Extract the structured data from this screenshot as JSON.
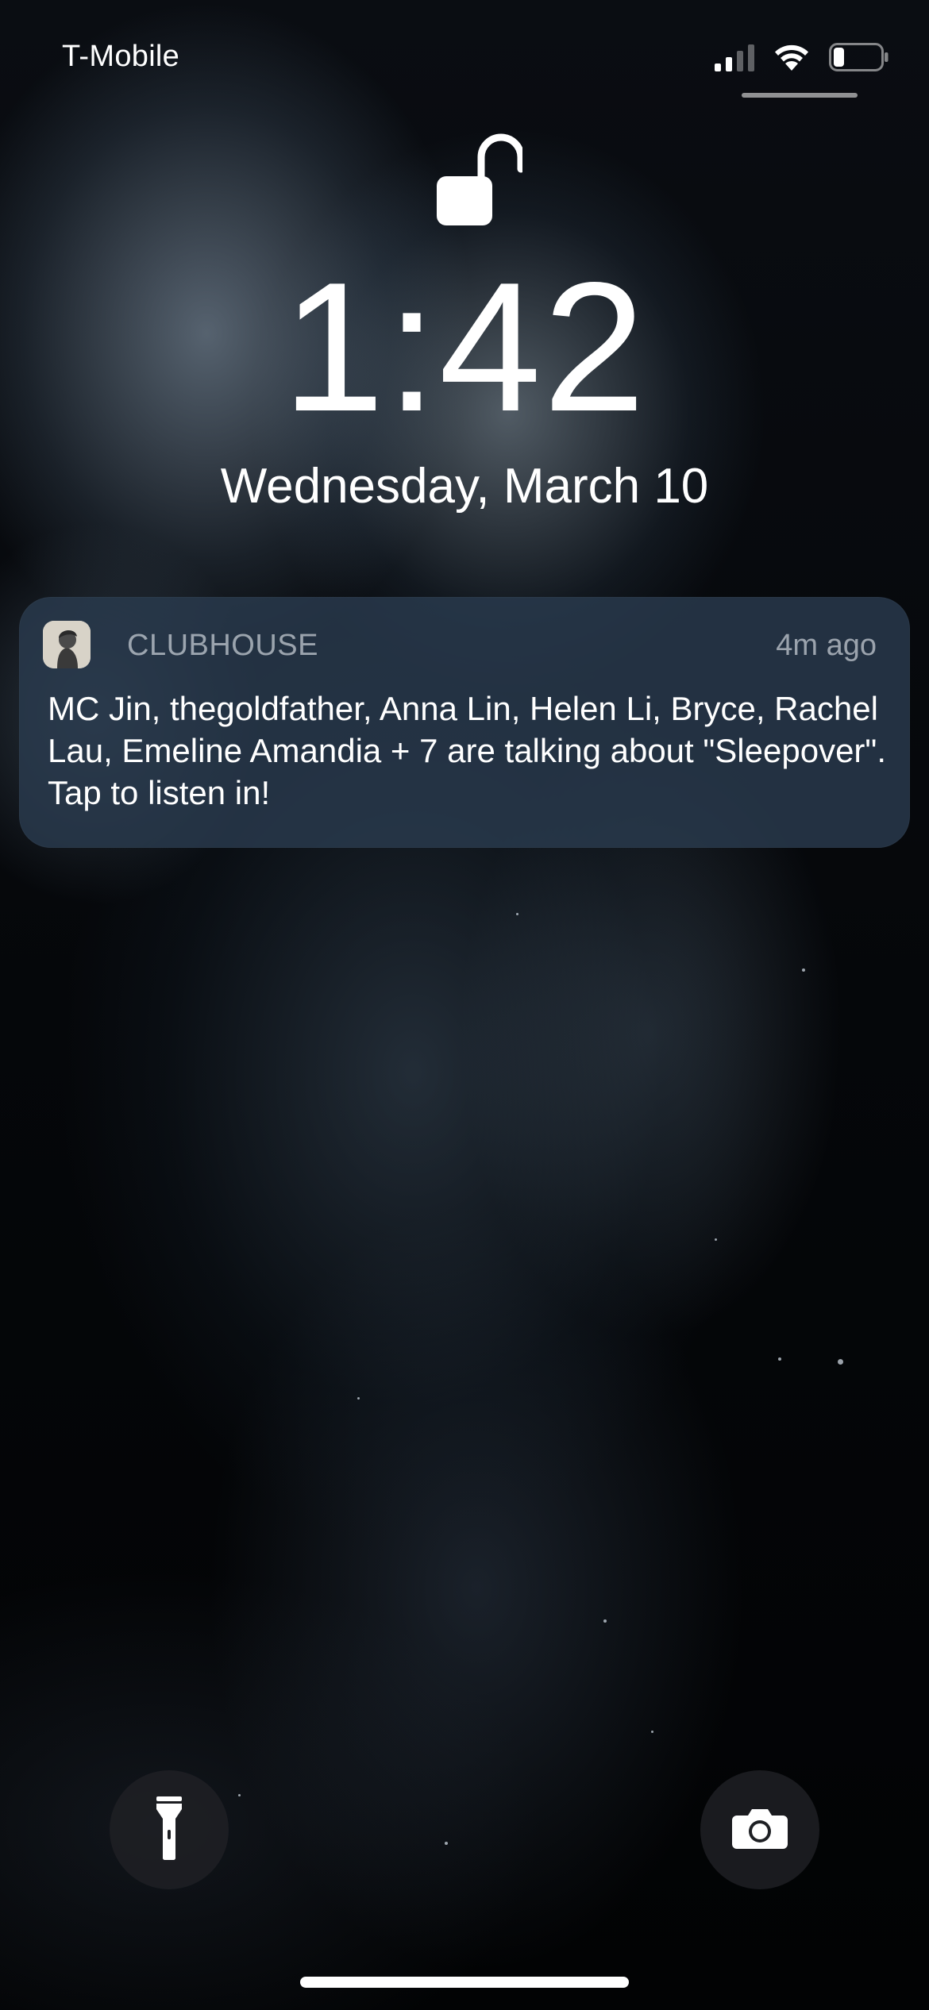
{
  "status_bar": {
    "carrier": "T-Mobile",
    "signal_icon": "cellular-signal-icon",
    "wifi_icon": "wifi-icon",
    "battery_icon": "battery-icon",
    "battery_level": 0.2,
    "signal_bars_active": 2
  },
  "lock": {
    "icon": "unlocked-padlock-icon"
  },
  "clock": {
    "time": "1:42",
    "date": "Wednesday, March 10"
  },
  "notification": {
    "app_icon": "clubhouse-app-icon",
    "app_name": "CLUBHOUSE",
    "time_ago": "4m ago",
    "body": "MC Jin, thegoldfather, Anna Lin, Helen Li, Bryce, Rachel Lau, Emeline Amandia + 7 are talking about \"Sleepover\". Tap to listen in!"
  },
  "quick_actions": {
    "flashlight_icon": "flashlight-icon",
    "camera_icon": "camera-icon"
  },
  "colors": {
    "notification_bg": "#2a3a4e",
    "text": "#ffffff",
    "secondary_text": "#a9b2bd"
  }
}
